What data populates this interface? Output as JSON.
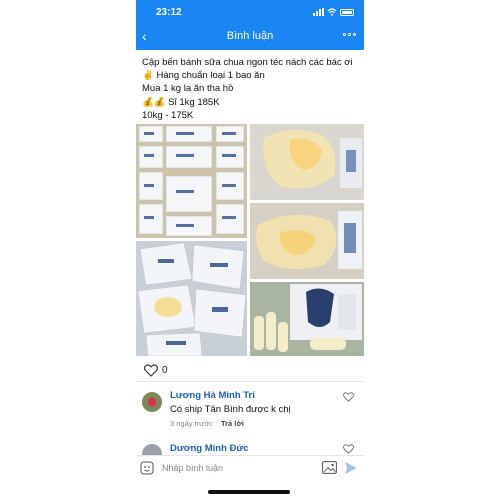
{
  "status_bar": {
    "time": "23:12"
  },
  "header": {
    "title": "Bình luận"
  },
  "post": {
    "lines": [
      "Cập bến bánh sữa chua ngon téc nách các bác ơi",
      "✌️ Hàng chuẩn loại 1 bao ăn",
      "Mua 1 kg la ăn tha hồ",
      "💰💰 Sỉ 1kg 185K",
      "10kg - 175K"
    ],
    "like_count": "0"
  },
  "comments": [
    {
      "author": "Lương Hà Minh Trí",
      "text": "Có ship Tân Bình được k chị",
      "time": "3 ngày trước",
      "reply_label": "Trả lời"
    },
    {
      "author": "Dương Minh Đức"
    }
  ],
  "composer": {
    "placeholder": "Nhập bình luận"
  },
  "colors": {
    "brand_blue": "#1a86f3",
    "author_blue": "#1d5fb8"
  },
  "icons": [
    "back-icon",
    "more-icon",
    "heart-icon",
    "sticker-icon",
    "image-icon",
    "send-icon"
  ]
}
